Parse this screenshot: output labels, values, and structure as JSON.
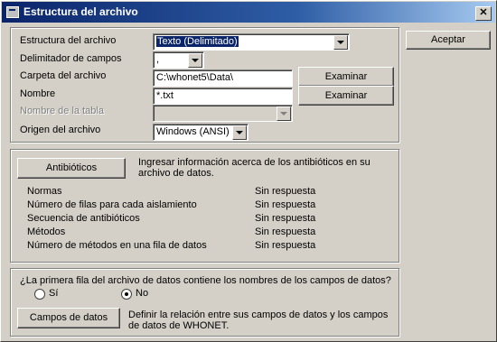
{
  "window": {
    "title": "Estructura del archivo",
    "close_glyph": "✕"
  },
  "accept_button": "Aceptar",
  "file_section": {
    "structure_label": "Estructura del archivo",
    "structure_value": "Texto (Delimitado)",
    "delimiter_label": "Delimitador de campos",
    "delimiter_value": ",",
    "folder_label": "Carpeta del archivo",
    "folder_value": "C:\\whonet5\\Data\\",
    "browse_label": "Examinar",
    "name_label": "Nombre",
    "name_value": "*.txt",
    "table_label": "Nombre de la tabla",
    "table_value": "",
    "origin_label": "Origen del archivo",
    "origin_value": "Windows (ANSI)"
  },
  "antibiotics_section": {
    "button_label": "Antibióticos",
    "description": "Ingresar información acerca de los antibióticos en su archivo de datos.",
    "rows": [
      {
        "label": "Normas",
        "status": "Sin respuesta"
      },
      {
        "label": "Número de filas para cada aislamiento",
        "status": "Sin respuesta"
      },
      {
        "label": "Secuencia de antibióticos",
        "status": "Sin respuesta"
      },
      {
        "label": "Métodos",
        "status": "Sin respuesta"
      },
      {
        "label": "Número de métodos en una fila de datos",
        "status": "Sin respuesta"
      }
    ]
  },
  "fields_section": {
    "question": "¿La primera fila del archivo de datos contiene los nombres de los campos de datos?",
    "option_yes": "Sí",
    "option_no": "No",
    "selected": "No",
    "button_label": "Campos de datos",
    "description": "Definir la relación entre sus campos de datos y los campos de datos de WHONET."
  }
}
